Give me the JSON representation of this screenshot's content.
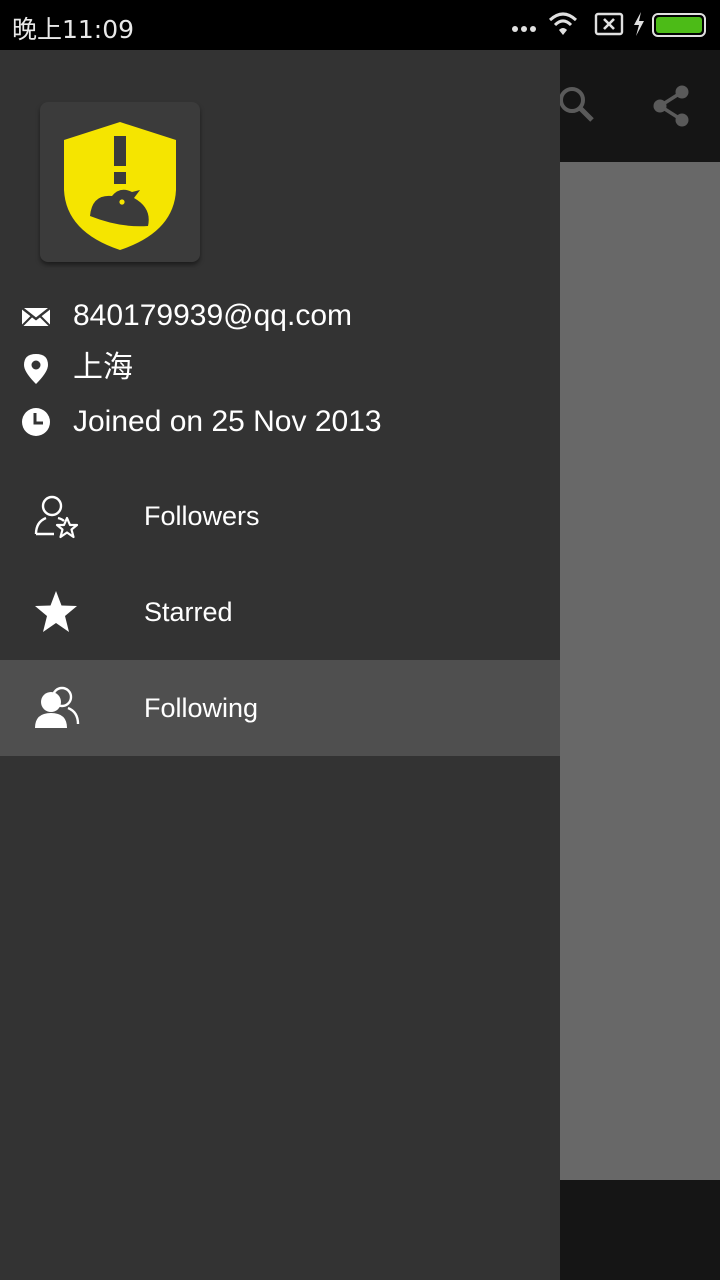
{
  "status_bar": {
    "time": "晚上11:09",
    "icons": [
      "more-dots-icon",
      "wifi-icon",
      "no-sim-icon",
      "charging-icon",
      "battery-icon"
    ],
    "battery_color": "#4cbb17"
  },
  "background_app": {
    "actions": [
      "search-icon",
      "share-icon"
    ]
  },
  "drawer": {
    "avatar_icon": "shield-bird-icon",
    "avatar_color": "#f5e500",
    "profile": {
      "email": "840179939@qq.com",
      "location": "上海",
      "joined": "Joined on 25 Nov 2013"
    },
    "menu": [
      {
        "label": "Followers",
        "icon": "followers-icon",
        "active": false
      },
      {
        "label": "Starred",
        "icon": "star-icon",
        "active": false
      },
      {
        "label": "Following",
        "icon": "following-icon",
        "active": true
      }
    ]
  }
}
